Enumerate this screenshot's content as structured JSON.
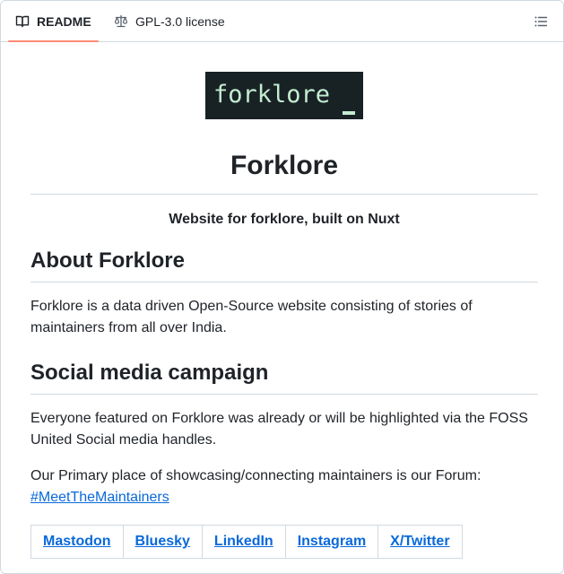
{
  "tabs": {
    "readme_label": "README",
    "license_label": "GPL-3.0 license",
    "outline_icon": "list-unordered-icon"
  },
  "logo": {
    "text": "forklore",
    "cursor": "_",
    "background": "#182225",
    "foreground": "#c4ecd1"
  },
  "readme": {
    "title": "Forklore",
    "subtitle": "Website for forklore, built on Nuxt",
    "about": {
      "heading": "About Forklore",
      "body": "Forklore is a data driven Open-Source website consisting of stories of maintainers from all over India."
    },
    "social": {
      "heading": "Social media campaign",
      "body1": "Everyone featured on Forklore was already or will be highlighted via the FOSS United Social media handles.",
      "body2": "Our Primary place of showcasing/connecting maintainers is our Forum:",
      "forum_link": "#MeetTheMaintainers"
    },
    "social_links": [
      "Mastodon",
      "Bluesky",
      "LinkedIn",
      "Instagram",
      "X/Twitter"
    ]
  },
  "colors": {
    "link": "#0969da",
    "tab_underline": "#fd8c73",
    "border": "#d1d9e0"
  }
}
